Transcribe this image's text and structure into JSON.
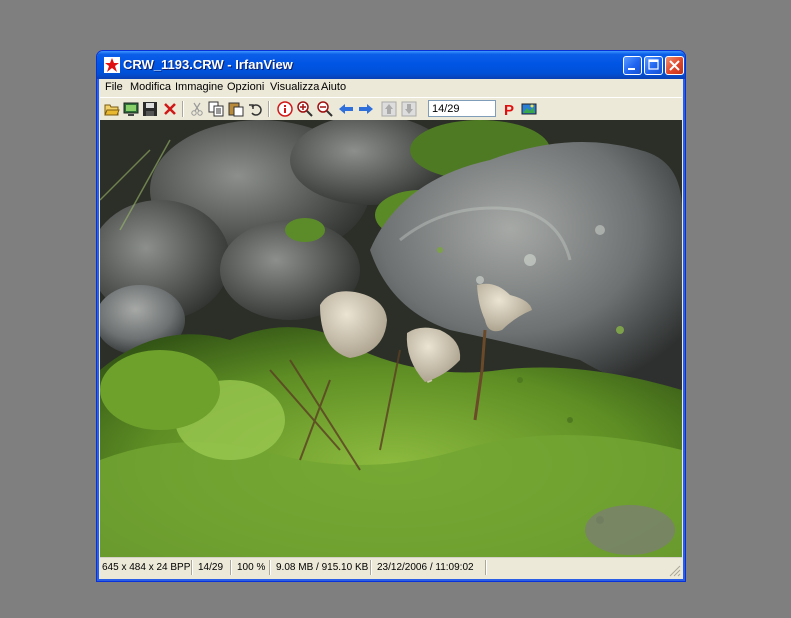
{
  "window": {
    "title": "CRW_1193.CRW - IrfanView"
  },
  "menu": {
    "items": [
      "File",
      "Modifica",
      "Immagine",
      "Opzioni",
      "Visualizza",
      "Aiuto"
    ]
  },
  "toolbar": {
    "page_value": "14/29",
    "icons": [
      "open-folder-icon",
      "slideshow-icon",
      "save-icon",
      "delete-icon",
      "cut-icon",
      "copy-icon",
      "paste-icon",
      "undo-icon",
      "info-icon",
      "zoom-in-icon",
      "zoom-out-icon",
      "previous-icon",
      "next-icon",
      "first-icon",
      "last-icon",
      "print-icon",
      "paint-icon"
    ]
  },
  "image": {
    "description_colors": {
      "moss": "#6e9a2e",
      "rock": "#7b7f80",
      "mushroom": "#cfc6b2"
    }
  },
  "status": {
    "dimensions": "645 x 484 x 24 BPP",
    "position": "14/29",
    "zoom": "100 %",
    "size": "9.08 MB / 915.10 KB",
    "datetime": "23/12/2006 / 11:09:02"
  },
  "colors": {
    "titlebar": "#0054e3",
    "close_button": "#e0462a",
    "desktop": "#7f7f7f"
  }
}
